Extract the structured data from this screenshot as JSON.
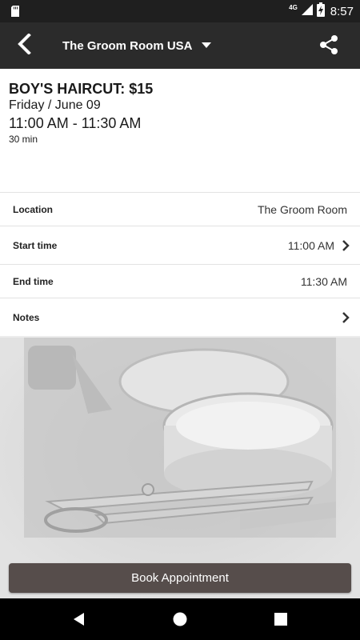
{
  "status_bar": {
    "network": "4G",
    "time": "8:57",
    "icons": [
      "sd-card-icon",
      "signal-icon",
      "battery-charging-icon"
    ]
  },
  "app_bar": {
    "title": "The Groom Room USA",
    "icons": [
      "back-arrow-icon",
      "caret-down-icon",
      "share-icon"
    ]
  },
  "appointment": {
    "service": "BOY'S HAIRCUT: $15",
    "date": "Friday / June 09",
    "time_range": "11:00 AM - 11:30 AM",
    "duration": "30 min"
  },
  "details": {
    "location": {
      "label": "Location",
      "value": "The Groom Room"
    },
    "start": {
      "label": "Start time",
      "value": "11:00 AM"
    },
    "end": {
      "label": "End time",
      "value": "11:30 AM"
    },
    "notes": {
      "label": "Notes"
    }
  },
  "actions": {
    "book_label": "Book Appointment"
  },
  "colors": {
    "app_bar": "#2b2b2b",
    "status_bar": "#1f1f1f",
    "book_button": "#564d4b",
    "nav_bar": "#000000"
  }
}
